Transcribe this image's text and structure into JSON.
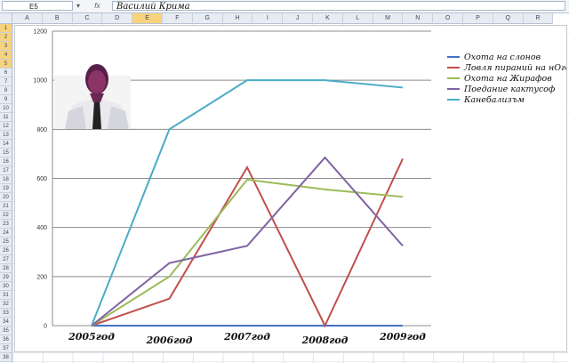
{
  "formula_bar": {
    "name_box": "E5",
    "fx_label": "fx",
    "content": "Василий Крима"
  },
  "columns": [
    "A",
    "B",
    "C",
    "D",
    "E",
    "F",
    "G",
    "H",
    "I",
    "J",
    "K",
    "L",
    "M",
    "N",
    "O",
    "P",
    "Q",
    "R"
  ],
  "selected_column": "E",
  "rows": [
    "1",
    "2",
    "3",
    "4",
    "5",
    "6",
    "7",
    "8",
    "9",
    "10",
    "11",
    "12",
    "13",
    "14",
    "15",
    "16",
    "17",
    "18",
    "19",
    "20",
    "21",
    "22",
    "23",
    "24",
    "25",
    "26",
    "27",
    "28",
    "29",
    "30",
    "31",
    "32",
    "33",
    "34",
    "35",
    "36",
    "37",
    "38"
  ],
  "selected_rows": [
    "1",
    "2",
    "3",
    "4",
    "5"
  ],
  "chart_data": {
    "type": "line",
    "categories": [
      "2005год",
      "2006год",
      "2007год",
      "2008год",
      "2009год"
    ],
    "ylim": [
      0,
      1200
    ],
    "yticks": [
      0,
      200,
      400,
      600,
      800,
      1000,
      1200
    ],
    "grid": true,
    "legend": "right",
    "series": [
      {
        "name": "Охота на слонов",
        "color": "#4472c4",
        "values": [
          0,
          0,
          0,
          0,
          0
        ]
      },
      {
        "name": "Ловля пираний на нОге",
        "color": "#c0504d",
        "values": [
          0,
          110,
          645,
          0,
          680
        ]
      },
      {
        "name": "Охота на Жирафов",
        "color": "#9bbb59",
        "values": [
          0,
          200,
          595,
          555,
          525
        ]
      },
      {
        "name": "Поедание кактусоф",
        "color": "#8064a2",
        "values": [
          0,
          255,
          325,
          685,
          325
        ]
      },
      {
        "name": "Канебализъм",
        "color": "#4bacc6",
        "values": [
          0,
          800,
          1000,
          1000,
          970
        ]
      }
    ]
  },
  "picture": {
    "description_icon": "person-photo"
  }
}
